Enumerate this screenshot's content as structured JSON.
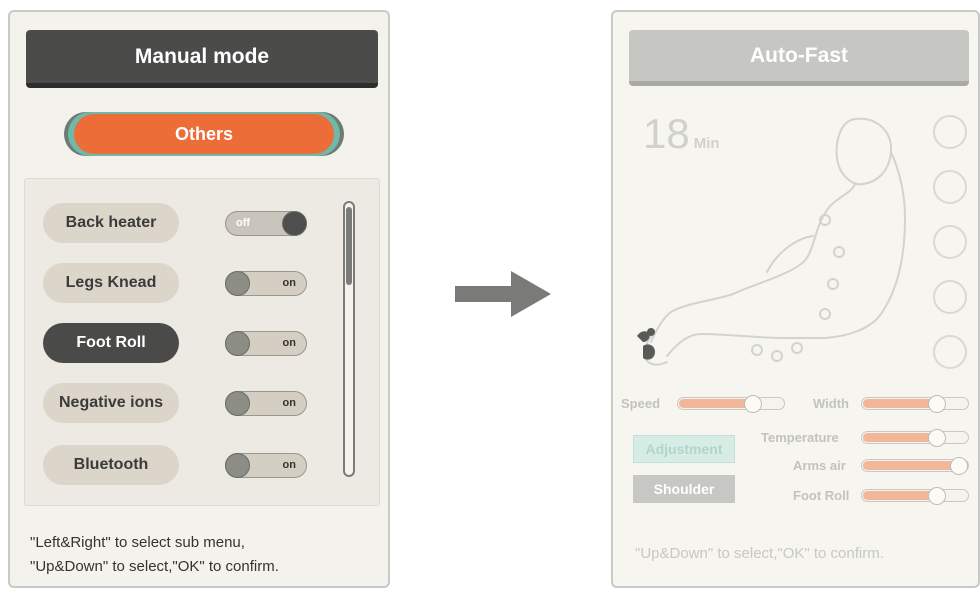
{
  "manual": {
    "title": "Manual mode",
    "category": "Others",
    "items": [
      {
        "label": "Back heater",
        "state": "off",
        "selected": false
      },
      {
        "label": "Legs Knead",
        "state": "on",
        "selected": false
      },
      {
        "label": "Foot Roll",
        "state": "on",
        "selected": true
      },
      {
        "label": "Negative ions",
        "state": "on",
        "selected": false
      },
      {
        "label": "Bluetooth",
        "state": "on",
        "selected": false
      }
    ],
    "help_line1": "\"Left&Right\" to select sub menu,",
    "help_line2": "\"Up&Down\" to select,\"OK\" to confirm."
  },
  "auto": {
    "title": "Auto-Fast",
    "time_value": "18",
    "time_unit": "Min",
    "speed_label": "Speed",
    "speed_level": 0.75,
    "width_label": "Width",
    "width_level": 0.75,
    "temperature_label": "Temperature",
    "temperature_level": 0.75,
    "arms_air_label": "Arms air",
    "arms_air_level": 1.0,
    "foot_roll_label": "Foot Roll",
    "foot_roll_level": 0.75,
    "adjustment_label": "Adjustment",
    "shoulder_label": "Shoulder",
    "help": "\"Up&Down\" to select,\"OK\" to confirm."
  },
  "colors": {
    "accent": "#ec6d38",
    "dark": "#4b4b49",
    "slider_fill": "#f2b698",
    "teal": "#6fb8aa"
  },
  "icons": [
    "arrow-right-icon",
    "massage-chair-figure-icon",
    "foot-roller-icon"
  ]
}
